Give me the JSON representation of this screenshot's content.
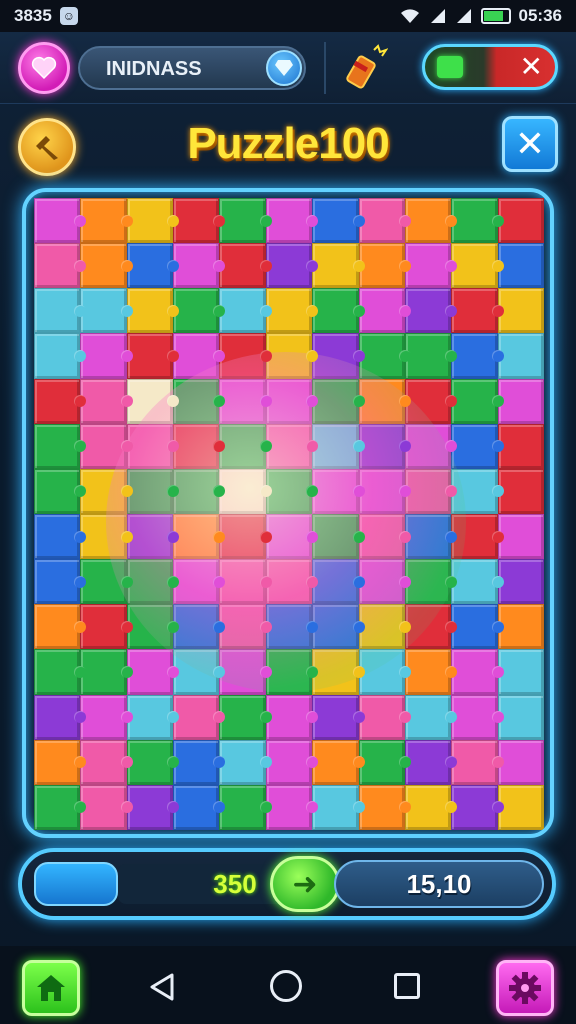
{
  "status_bar": {
    "left_text": "3835",
    "time": "05:36",
    "wifi_icon": "wifi-icon",
    "signal_icon": "signal-icon",
    "battery_icon": "battery-icon"
  },
  "top_bar": {
    "heart_icon": "heart-icon",
    "player_name": "INIDNASS",
    "gem_icon": "gem-icon",
    "firework_icon": "firework-icon",
    "toggle_close_label": "✕"
  },
  "title_row": {
    "back_icon": "hammer-back-icon",
    "title": "Puzzle100",
    "close_label": "✕"
  },
  "board": {
    "columns": 11,
    "rows": 14,
    "palette": [
      "#2a6ee0",
      "#f2c21a",
      "#e02e3a",
      "#26b34a",
      "#e04ed8",
      "#ff8a1e",
      "#8c3ad6",
      "#f05aa8",
      "#58c8e0",
      "#f5e9c8",
      "#7fe04a"
    ]
  },
  "progress": {
    "fill_fraction": 0.2,
    "current_score": "350",
    "go_label": "➜",
    "target_score": "15,10"
  },
  "nav_bar": {
    "home_icon": "home-icon",
    "back_icon": "triangle-back-icon",
    "home_circle_icon": "circle-home-icon",
    "recent_icon": "square-recent-icon",
    "settings_icon": "gear-icon"
  },
  "colors": {
    "accent_blue": "#55ccff",
    "title_yellow": "#ffe63a",
    "score_green": "#d6ff3a"
  }
}
